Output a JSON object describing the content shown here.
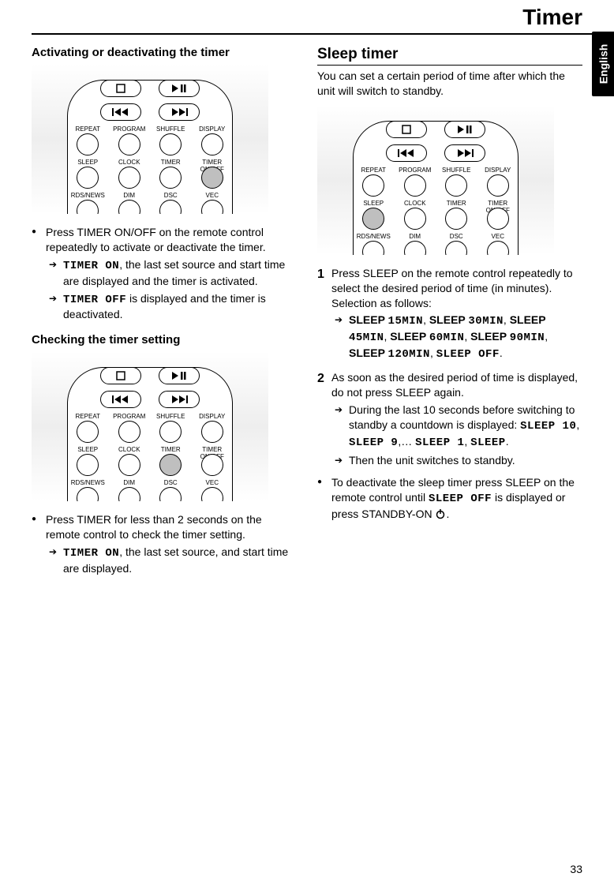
{
  "title": "Timer",
  "language_tab": "English",
  "page_number": "33",
  "remote": {
    "row1": [
      "REPEAT",
      "PROGRAM",
      "SHUFFLE",
      "DISPLAY"
    ],
    "row2": [
      "SLEEP",
      "CLOCK",
      "TIMER",
      "TIMER ON/OFF"
    ],
    "row3": [
      "RDS/NEWS",
      "DIM",
      "DSC",
      "VEC"
    ]
  },
  "left": {
    "h1": "Activating or deactivating the timer",
    "b1": "Press TIMER ON/OFF on the remote control repeatedly to activate or deactivate the timer.",
    "a1_code": "TIMER ON",
    "a1_text": ", the last set source and start time are displayed and the timer is activated.",
    "a2_code": "TIMER OFF",
    "a2_text": " is displayed and the timer is deactivated.",
    "h2": "Checking the timer setting",
    "b2": "Press TIMER for less than 2 seconds on the remote control to check the timer setting.",
    "a3_code": "TIMER ON",
    "a3_text": ", the last set source, and start time are displayed."
  },
  "right": {
    "h1": "Sleep timer",
    "intro": "You can set a certain period of time after which the unit will switch to standby.",
    "s1": "Press SLEEP on the remote control repeatedly to select the desired period of time (in minutes). Selection as follows:",
    "s1_seq_parts": {
      "p1": "SLEEP ",
      "c1": "15MIN",
      "d1": ", ",
      "p2": "SLEEP ",
      "c2": "30MIN",
      "d2": ", ",
      "p3": "SLEEP ",
      "c3": "45MIN",
      "d3": ", ",
      "p4": "SLEEP ",
      "c4": "60MIN",
      "d4": ", ",
      "p5": "SLEEP ",
      "c5": "90MIN",
      "d5": ", ",
      "p6": "SLEEP ",
      "c6": "120MIN",
      "d6": ", ",
      "c7": "SLEEP OFF",
      "d7": "."
    },
    "s2": "As soon as the desired period of time is displayed, do not press SLEEP again.",
    "s2a_pre": "During the last 10 seconds before switching to standby a countdown is displayed: ",
    "s2a_c1": "SLEEP 10",
    "s2a_d1": ", ",
    "s2a_c2": "SLEEP 9",
    "s2a_d2": ",… ",
    "s2a_c3": "SLEEP 1",
    "s2a_d3": ", ",
    "s2a_c4": "SLEEP",
    "s2a_d4": ".",
    "s2b": "Then the unit switches to standby.",
    "b3_pre": "To deactivate the sleep timer press SLEEP on the remote control until ",
    "b3_code": "SLEEP OFF",
    "b3_mid": " is displayed or press STANDBY-ON ",
    "b3_post": "."
  }
}
